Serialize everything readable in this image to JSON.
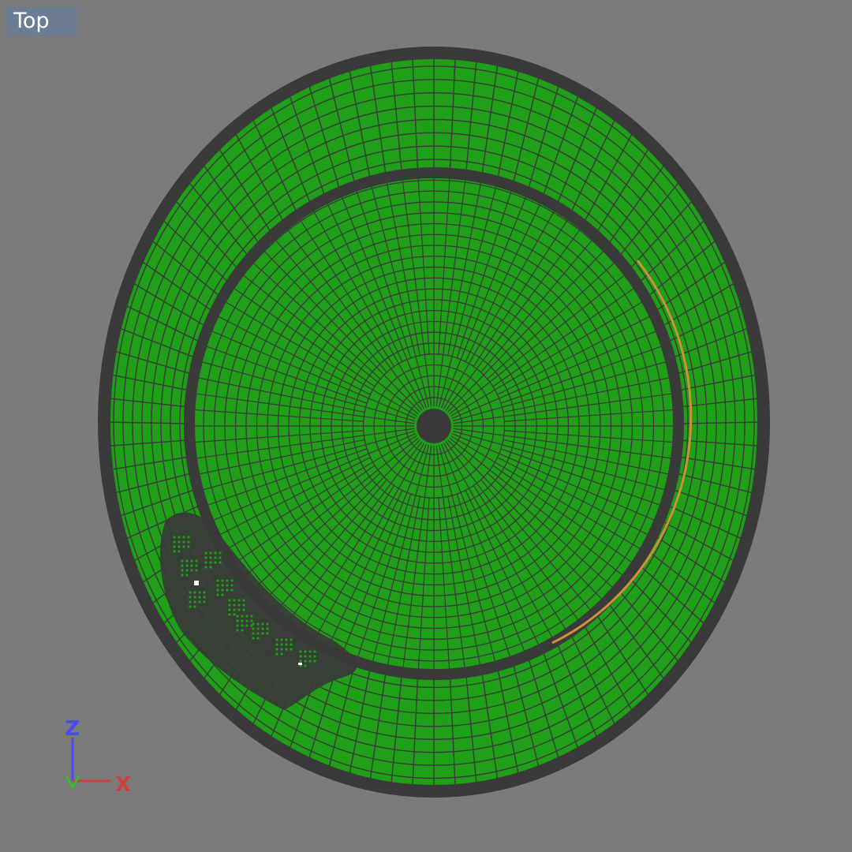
{
  "viewport": {
    "view_name": "Top",
    "background_color": "#7b7b7b",
    "label_background_color": "#6c7c93",
    "mesh_fill_color": "#1f9e17",
    "mesh_line_color": "#3a3a3a",
    "highlight_edge_color": "#d0903a"
  },
  "axis_gizmo": {
    "z_label": "Z",
    "x_label": "X",
    "z_color": "#4a4aff",
    "x_color": "#d04040",
    "y_color": "#30c030"
  }
}
